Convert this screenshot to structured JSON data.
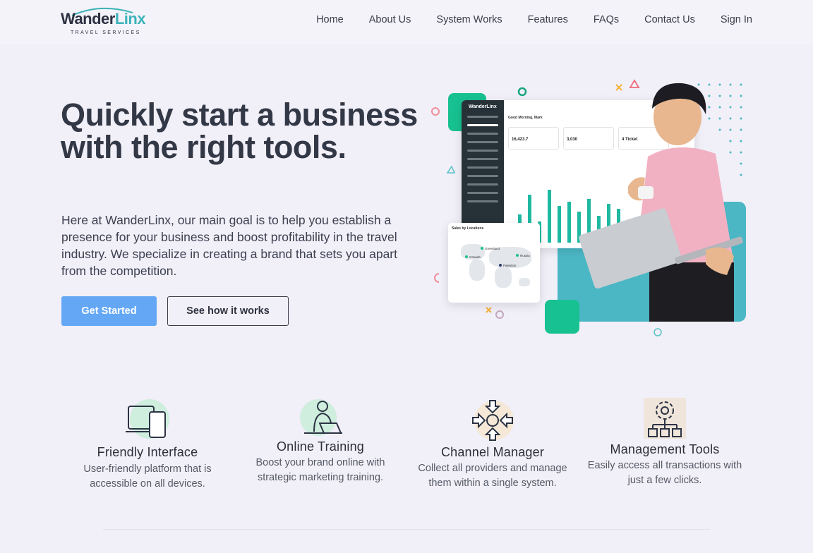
{
  "brand": {
    "name_part1": "Wander",
    "name_part2": "Linx",
    "tagline": "TRAVEL SERVICES"
  },
  "nav": {
    "items": [
      {
        "label": "Home"
      },
      {
        "label": "About Us"
      },
      {
        "label": "System Works"
      },
      {
        "label": "Features"
      },
      {
        "label": "FAQs"
      },
      {
        "label": "Contact Us"
      },
      {
        "label": "Sign In"
      }
    ]
  },
  "hero": {
    "title": "Quickly start a business with the right tools.",
    "description": "Here at WanderLinx, our main goal is to help you establish a presence for your business and boost profitability in the travel industry. We specialize in creating a brand that sets you apart from the competition.",
    "primary_button": "Get Started",
    "secondary_button": "See how it works"
  },
  "illustration": {
    "dashboard_greeting": "Good Morning, Mark",
    "cards": [
      {
        "value": "16,423.7"
      },
      {
        "value": "3,030"
      },
      {
        "value": "4 Ticket"
      }
    ],
    "map_title": "Sales by Locations",
    "map_labels": [
      "Greenland",
      "Canada",
      "Russia",
      "Palestine"
    ]
  },
  "features": [
    {
      "icon": "devices-icon",
      "title": "Friendly Interface",
      "description": "User-friendly platform that is accessible on all devices."
    },
    {
      "icon": "laptop-user-icon",
      "title": "Online Training",
      "description": "Boost your brand online with strategic marketing training."
    },
    {
      "icon": "channel-arrows-icon",
      "title": "Channel Manager",
      "description": "Collect all providers and manage them within a single system."
    },
    {
      "icon": "gear-network-icon",
      "title": "Management Tools",
      "description": "Easily access all transactions with just a few clicks."
    }
  ],
  "colors": {
    "accent_blue": "#64a8f5",
    "brand_teal": "#3bb3b9",
    "green": "#17c191",
    "background": "#f1eff8"
  }
}
